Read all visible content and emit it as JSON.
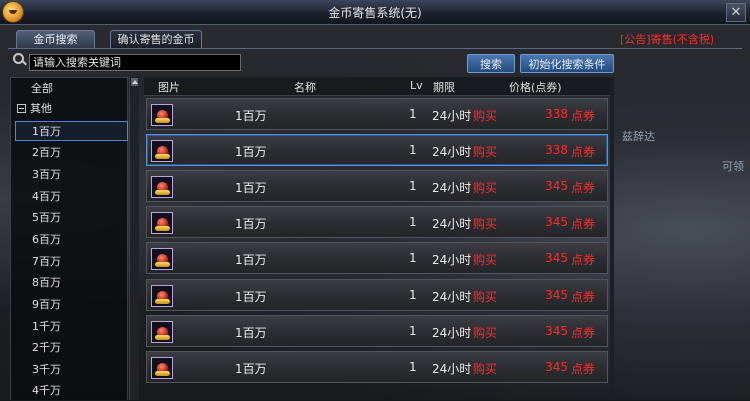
{
  "window": {
    "title": "金币寄售系统(无)",
    "close_glyph": "✕",
    "notice": "[公告]寄售(不含税)"
  },
  "tabs": [
    {
      "label": "金币搜索",
      "active": true
    },
    {
      "label": "确认寄售的金币",
      "active": false
    }
  ],
  "search": {
    "placeholder": "请输入搜索关键词",
    "search_button": "搜索",
    "reset_button": "初始化搜索条件"
  },
  "sidebar": {
    "all_label": "全部",
    "group_label": "其他",
    "items": [
      "1百万",
      "2百万",
      "3百万",
      "4百万",
      "5百万",
      "6百万",
      "7百万",
      "8百万",
      "9百万",
      "1千万",
      "2千万",
      "3千万",
      "4千万"
    ],
    "selected_index": 0
  },
  "table": {
    "headers": {
      "icon": "图片",
      "name": "名称",
      "lv": "Lv",
      "period": "期限",
      "price": "价格(点券)"
    },
    "rows": [
      {
        "name": "1百万",
        "lv": "1",
        "period": "24小时",
        "action": "购买",
        "price": "338",
        "unit": "点券"
      },
      {
        "name": "1百万",
        "lv": "1",
        "period": "24小时",
        "action": "购买",
        "price": "338",
        "unit": "点券"
      },
      {
        "name": "1百万",
        "lv": "1",
        "period": "24小时",
        "action": "购买",
        "price": "345",
        "unit": "点券"
      },
      {
        "name": "1百万",
        "lv": "1",
        "period": "24小时",
        "action": "购买",
        "price": "345",
        "unit": "点券"
      },
      {
        "name": "1百万",
        "lv": "1",
        "period": "24小时",
        "action": "购买",
        "price": "345",
        "unit": "点券"
      },
      {
        "name": "1百万",
        "lv": "1",
        "period": "24小时",
        "action": "购买",
        "price": "345",
        "unit": "点券"
      },
      {
        "name": "1百万",
        "lv": "1",
        "period": "24小时",
        "action": "购买",
        "price": "345",
        "unit": "点券"
      },
      {
        "name": "1百万",
        "lv": "1",
        "period": "24小时",
        "action": "购买",
        "price": "345",
        "unit": "点券"
      }
    ],
    "selected_row": 1
  },
  "background": {
    "label_1": "兹辞达",
    "label_2": "可领"
  },
  "colors": {
    "price_red": "#ff2a2a",
    "selection_blue": "#5a8ed8",
    "button_blue": "#234a80"
  }
}
